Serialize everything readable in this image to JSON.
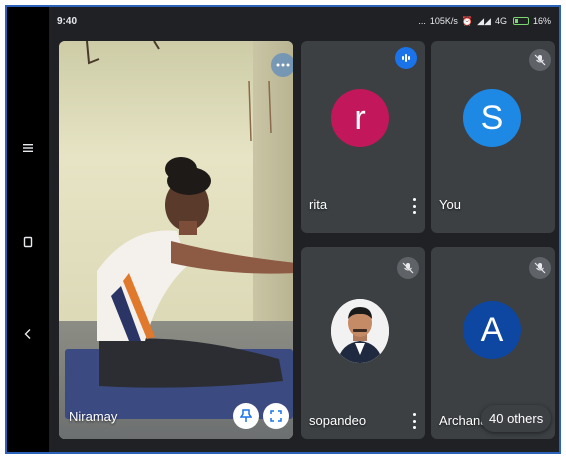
{
  "status_bar": {
    "time": "9:40",
    "dots": "...",
    "network_speed": "105K/s",
    "network": "4G",
    "battery": "16%"
  },
  "nav": {
    "menu_icon": "menu-icon",
    "home_icon": "square-icon",
    "back_icon": "back-icon"
  },
  "main_tile": {
    "name": "Niramay"
  },
  "tiles": [
    {
      "name": "rita",
      "initial": "r",
      "color": "#c2185b"
    },
    {
      "name": "You",
      "initial": "S",
      "color": "#1e88e5"
    },
    {
      "name": "sopandeo"
    },
    {
      "name": "Archana",
      "initial": "A",
      "color": "#0d47a1"
    }
  ],
  "others_label": "40 others",
  "colors": {
    "accent": "#1a73e8",
    "frame": "#2b63b8",
    "background": "#202124",
    "tile": "#3c4043"
  }
}
